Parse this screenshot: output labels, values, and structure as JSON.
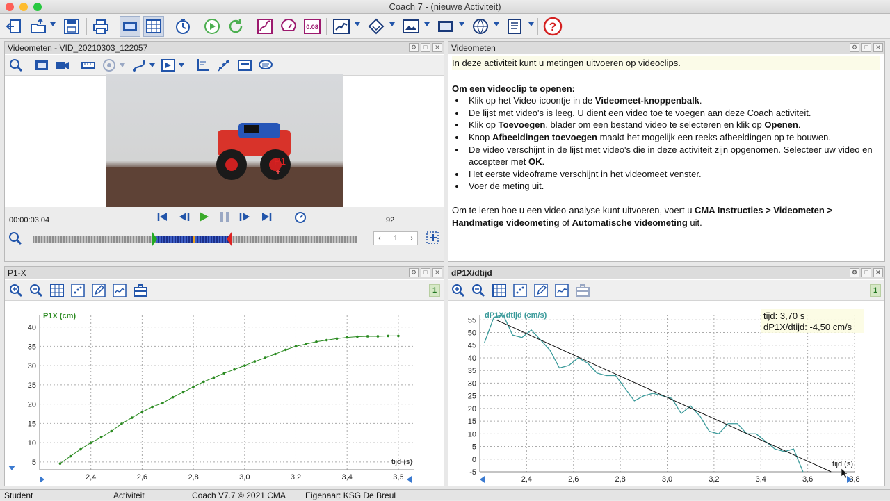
{
  "window": {
    "title": "Coach 7 - (nieuwe Activiteit)"
  },
  "video_panel": {
    "title": "Videometen - VID_20210303_122057",
    "point_label": "P1",
    "time": "00:00:03,04",
    "frame": "92",
    "step": "1"
  },
  "text_panel": {
    "title": "Videometen",
    "intro": "In deze activiteit kunt u metingen uitvoeren op videoclips.",
    "heading": "Om een videoclip te openen:",
    "bullets": [
      {
        "parts": [
          {
            "t": "Klik op het Video-icoontje in de "
          },
          {
            "b": "Videomeet-knoppenbalk"
          },
          {
            "t": "."
          }
        ]
      },
      {
        "parts": [
          {
            "t": "De lijst met video's is leeg. U dient een video toe te voegen aan deze Coach activiteit."
          }
        ]
      },
      {
        "parts": [
          {
            "t": "Klik op "
          },
          {
            "b": "Toevoegen"
          },
          {
            "t": ", blader om een bestand video te selecteren en klik op "
          },
          {
            "b": "Openen"
          },
          {
            "t": "."
          }
        ]
      },
      {
        "parts": [
          {
            "t": "Knop "
          },
          {
            "b": "Afbeeldingen toevoegen"
          },
          {
            "t": " maakt het mogelijk een reeks afbeeldingen op te bouwen."
          }
        ]
      },
      {
        "parts": [
          {
            "t": "De video verschijnt in de lijst met video's die in deze activiteit zijn opgenomen. Selecteer uw video en accepteer met "
          },
          {
            "b": "OK"
          },
          {
            "t": "."
          }
        ]
      },
      {
        "parts": [
          {
            "t": "Het eerste videoframe verschijnt in het videomeet venster."
          }
        ]
      },
      {
        "parts": [
          {
            "t": "Voer de meting uit."
          }
        ]
      }
    ],
    "outro": [
      {
        "t": "Om te leren hoe u een video-analyse kunt uitvoeren, voert u "
      },
      {
        "b": "CMA Instructies > Videometen > Handmatige videometing"
      },
      {
        "t": " of "
      },
      {
        "b": "Automatische videometing"
      },
      {
        "t": " uit."
      }
    ]
  },
  "graph1": {
    "title": "P1-X",
    "counter": "1"
  },
  "graph2": {
    "title": "dP1X/dtijd",
    "counter": "1",
    "tooltip_line1": "tijd: 3,70 s",
    "tooltip_line2": "dP1X/dtijd: -4,50 cm/s"
  },
  "status": {
    "user": "Student",
    "activity": "Activiteit",
    "version": "Coach V7.7 © 2021 CMA",
    "owner": "Eigenaar: KSG De Breul"
  },
  "colors": {
    "position_series": "#2a8a20",
    "velocity_series": "#3a9a9a",
    "fit_line": "#111111",
    "video_scale": "#2233aa",
    "start_marker": "#22aa22",
    "end_marker": "#dd2222"
  },
  "chart_data": [
    {
      "type": "scatter",
      "title": "P1-X",
      "xlabel": "tijd (s)",
      "ylabel": "P1X (cm)",
      "xlim": [
        2.2,
        3.66
      ],
      "ylim": [
        3,
        43
      ],
      "xticks": [
        "2,4",
        "2,6",
        "2,8",
        "3,0",
        "3,2",
        "3,4",
        "3,6"
      ],
      "yticks": [
        "5",
        "10",
        "15",
        "20",
        "25",
        "30",
        "35",
        "40"
      ],
      "grid": true,
      "series": [
        {
          "name": "P1X (cm)",
          "x": [
            2.28,
            2.32,
            2.36,
            2.4,
            2.44,
            2.48,
            2.52,
            2.56,
            2.6,
            2.64,
            2.68,
            2.72,
            2.76,
            2.8,
            2.84,
            2.88,
            2.92,
            2.96,
            3.0,
            3.04,
            3.08,
            3.12,
            3.16,
            3.2,
            3.24,
            3.28,
            3.32,
            3.36,
            3.4,
            3.44,
            3.48,
            3.52,
            3.56,
            3.6
          ],
          "y": [
            4.6,
            6.5,
            8.3,
            10.0,
            11.4,
            13.0,
            14.9,
            16.5,
            18.0,
            19.3,
            20.3,
            21.8,
            23.1,
            24.5,
            25.8,
            26.9,
            28.0,
            29.0,
            30.0,
            31.1,
            32.0,
            33.0,
            34.1,
            35.0,
            35.6,
            36.2,
            36.6,
            37.0,
            37.3,
            37.5,
            37.6,
            37.6,
            37.7,
            37.7
          ]
        }
      ]
    },
    {
      "type": "line",
      "title": "dP1X/dtijd",
      "xlabel": "tijd (s)",
      "ylabel": "dP1X/dtijd (cm/s)",
      "xlim": [
        2.2,
        3.8
      ],
      "ylim": [
        -5,
        57
      ],
      "xticks": [
        "2,4",
        "2,6",
        "2,8",
        "3,0",
        "3,2",
        "3,4",
        "3,6",
        "3,8"
      ],
      "yticks": [
        "-5",
        "0",
        "5",
        "10",
        "15",
        "20",
        "25",
        "30",
        "35",
        "40",
        "45",
        "50",
        "55"
      ],
      "grid": true,
      "series": [
        {
          "name": "dP1X/dtijd (cm/s)",
          "x": [
            2.22,
            2.26,
            2.3,
            2.34,
            2.38,
            2.42,
            2.46,
            2.5,
            2.54,
            2.58,
            2.62,
            2.66,
            2.7,
            2.74,
            2.78,
            2.82,
            2.86,
            2.9,
            2.94,
            2.98,
            3.02,
            3.06,
            3.1,
            3.14,
            3.18,
            3.22,
            3.26,
            3.3,
            3.34,
            3.38,
            3.42,
            3.46,
            3.5,
            3.54,
            3.58
          ],
          "y": [
            46,
            56,
            57,
            49,
            48,
            51,
            47,
            43,
            36,
            37,
            40,
            38,
            34,
            33,
            33,
            28,
            23,
            25,
            26,
            25,
            24,
            18,
            21,
            17,
            11,
            10,
            14,
            14,
            10,
            10,
            7,
            4,
            3,
            4,
            -5
          ]
        },
        {
          "name": "fit",
          "x": [
            2.27,
            3.7
          ],
          "y": [
            55,
            -5
          ]
        }
      ]
    }
  ]
}
